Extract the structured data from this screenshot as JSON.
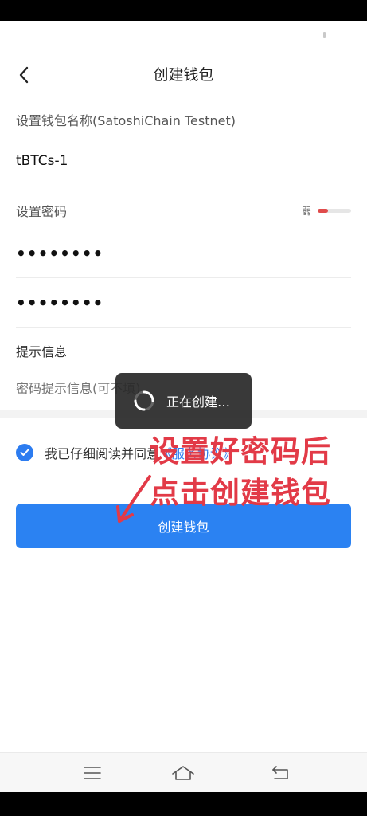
{
  "header": {
    "title": "创建钱包"
  },
  "form": {
    "wallet_name_label": "设置钱包名称(SatoshiChain Testnet)",
    "wallet_name_value": "tBTCs-1",
    "password_label": "设置密码",
    "password_strength_text": "弱",
    "password_strength_level": 0.3,
    "password_value": "••••••••",
    "password_confirm_value": "••••••••",
    "hint_label": "提示信息",
    "hint_placeholder": "密码提示信息(可不填)"
  },
  "agreement": {
    "text": "我已仔细阅读并同意",
    "link": "《服务协议》"
  },
  "create_button_label": "创建钱包",
  "toast": {
    "text": "正在创建…"
  },
  "annotation": {
    "line1": "设置好密码后",
    "line2": "点击创建钱包"
  },
  "icons": {
    "back": "back-arrow-icon",
    "check": "checkmark-icon",
    "spinner": "loading-spinner-icon",
    "nav_menu": "menu-icon",
    "nav_home": "home-icon",
    "nav_back": "return-icon"
  },
  "colors": {
    "accent": "#2b82f2",
    "weak": "#e04b4b",
    "annotation": "#e23a47"
  }
}
